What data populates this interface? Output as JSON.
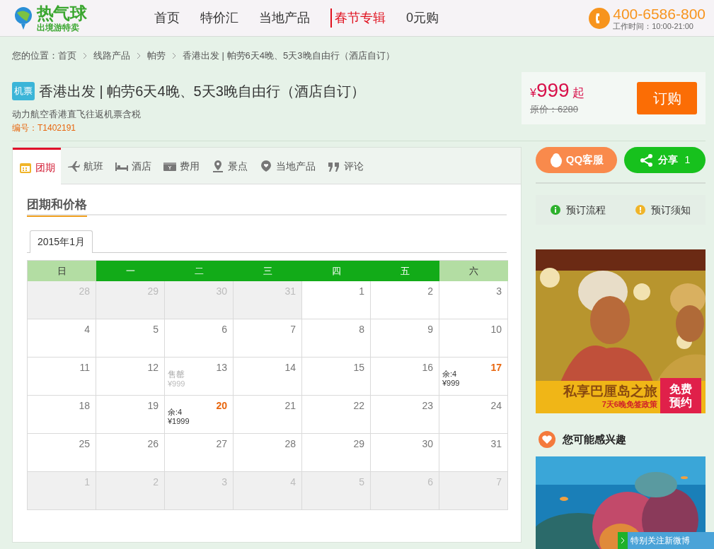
{
  "header": {
    "logo": {
      "name": "热气球",
      "tagline": "出境游特卖"
    },
    "nav": [
      {
        "label": "首页",
        "highlight": false
      },
      {
        "label": "特价汇",
        "highlight": false
      },
      {
        "label": "当地产品",
        "highlight": false
      },
      {
        "label": "春节专辑",
        "highlight": true
      },
      {
        "label": "0元购",
        "highlight": false
      }
    ],
    "phone": "400-6586-800",
    "hours": "工作时间：10:00-21:00"
  },
  "breadcrumb": {
    "label": "您的位置：",
    "items": [
      "首页",
      "线路产品",
      "帕劳",
      "香港出发 | 帕劳6天4晚、5天3晚自由行（酒店自订）"
    ]
  },
  "product": {
    "tag": "机票",
    "title": "香港出发 | 帕劳6天4晚、5天3晚自由行（酒店自订）",
    "subtitle": "动力航空香港直飞往返机票含税",
    "code": "编号：T1402191",
    "price": {
      "currency": "¥",
      "amount": "999",
      "suffix": "起",
      "original": "原价：6280"
    },
    "buy_button": "订购"
  },
  "tabs": [
    {
      "label": "团期",
      "selected": true
    },
    {
      "label": "航班",
      "selected": false
    },
    {
      "label": "酒店",
      "selected": false
    },
    {
      "label": "费用",
      "selected": false
    },
    {
      "label": "景点",
      "selected": false
    },
    {
      "label": "当地产品",
      "selected": false
    },
    {
      "label": "评论",
      "selected": false
    }
  ],
  "section_title": "团期和价格",
  "calendar": {
    "month_tab": "2015年1月",
    "weekdays": [
      {
        "label": "日",
        "weekend": true
      },
      {
        "label": "一",
        "weekend": false
      },
      {
        "label": "二",
        "weekend": false
      },
      {
        "label": "三",
        "weekend": false
      },
      {
        "label": "四",
        "weekend": false
      },
      {
        "label": "五",
        "weekend": false
      },
      {
        "label": "六",
        "weekend": true
      }
    ],
    "days": [
      {
        "day": "28",
        "kind": "outside"
      },
      {
        "day": "29",
        "kind": "outside"
      },
      {
        "day": "30",
        "kind": "outside"
      },
      {
        "day": "31",
        "kind": "outside"
      },
      {
        "day": "1",
        "kind": "plain"
      },
      {
        "day": "2",
        "kind": "plain"
      },
      {
        "day": "3",
        "kind": "plain"
      },
      {
        "day": "4",
        "kind": "plain"
      },
      {
        "day": "5",
        "kind": "plain"
      },
      {
        "day": "6",
        "kind": "plain"
      },
      {
        "day": "7",
        "kind": "plain"
      },
      {
        "day": "8",
        "kind": "plain"
      },
      {
        "day": "9",
        "kind": "plain"
      },
      {
        "day": "10",
        "kind": "plain"
      },
      {
        "day": "11",
        "kind": "plain"
      },
      {
        "day": "12",
        "kind": "plain"
      },
      {
        "day": "13",
        "kind": "soldout",
        "status": "售罄",
        "price": "¥999"
      },
      {
        "day": "14",
        "kind": "plain"
      },
      {
        "day": "15",
        "kind": "plain"
      },
      {
        "day": "16",
        "kind": "plain"
      },
      {
        "day": "17",
        "kind": "available",
        "remaining": "余:4",
        "price": "¥999"
      },
      {
        "day": "18",
        "kind": "plain"
      },
      {
        "day": "19",
        "kind": "plain"
      },
      {
        "day": "20",
        "kind": "available",
        "remaining": "余:4",
        "price": "¥1999"
      },
      {
        "day": "21",
        "kind": "plain"
      },
      {
        "day": "22",
        "kind": "plain"
      },
      {
        "day": "23",
        "kind": "plain"
      },
      {
        "day": "24",
        "kind": "plain"
      },
      {
        "day": "25",
        "kind": "plain"
      },
      {
        "day": "26",
        "kind": "plain"
      },
      {
        "day": "27",
        "kind": "plain"
      },
      {
        "day": "28",
        "kind": "plain"
      },
      {
        "day": "29",
        "kind": "plain"
      },
      {
        "day": "30",
        "kind": "plain"
      },
      {
        "day": "31",
        "kind": "plain"
      },
      {
        "day": "1",
        "kind": "outside"
      },
      {
        "day": "2",
        "kind": "outside"
      },
      {
        "day": "3",
        "kind": "outside"
      },
      {
        "day": "4",
        "kind": "outside"
      },
      {
        "day": "5",
        "kind": "outside"
      },
      {
        "day": "6",
        "kind": "outside"
      },
      {
        "day": "7",
        "kind": "outside"
      }
    ]
  },
  "sidebar": {
    "qq_button": "QQ客服",
    "share_button": {
      "label": "分享",
      "count": "1"
    },
    "links": [
      {
        "label": "预订流程"
      },
      {
        "label": "预订须知"
      }
    ],
    "banner": {
      "title": "私享巴厘岛之旅",
      "subtitle": "7天6晚免签政策",
      "badge": [
        "免费",
        "预约"
      ]
    },
    "interest_title": "您可能感兴趣",
    "follow_bar": "特别关注新微博"
  }
}
